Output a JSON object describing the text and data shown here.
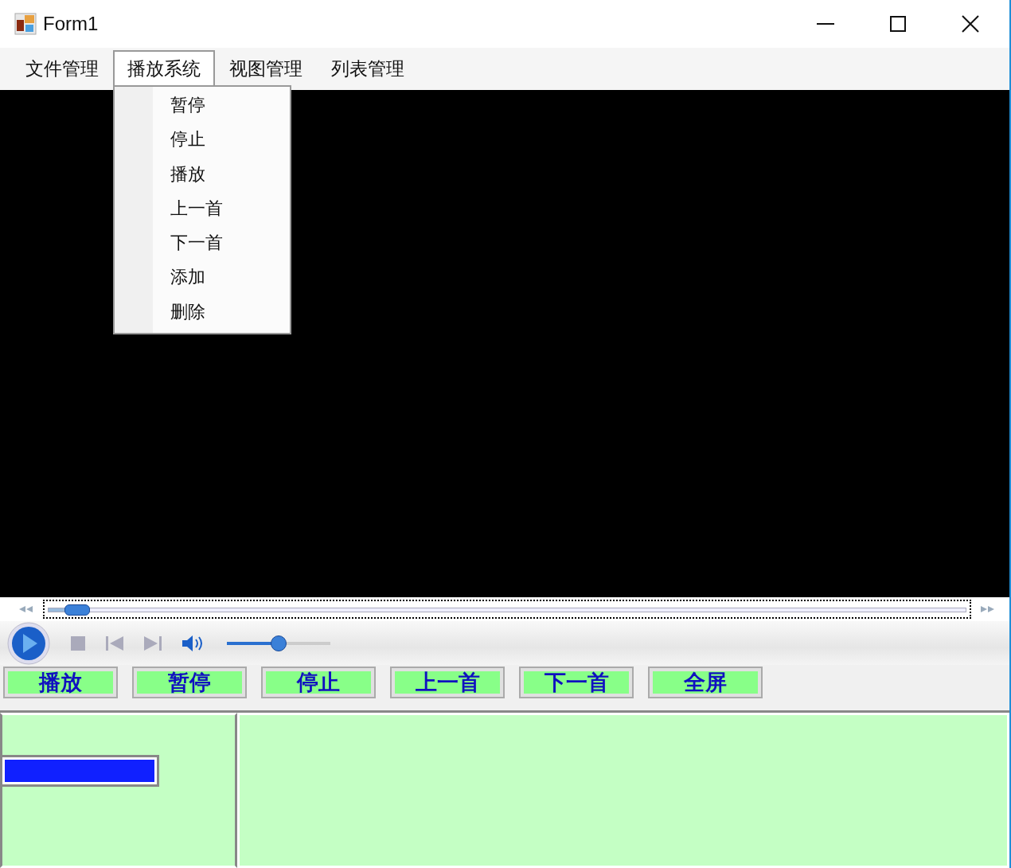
{
  "window": {
    "title": "Form1"
  },
  "menu": [
    {
      "label": "文件管理",
      "selected": false
    },
    {
      "label": "播放系统",
      "selected": true
    },
    {
      "label": "视图管理",
      "selected": false
    },
    {
      "label": "列表管理",
      "selected": false
    }
  ],
  "dropdown": [
    "暂停",
    "停止",
    "播放",
    "上一首",
    "下一首",
    "添加",
    "删除"
  ],
  "player": {
    "seek": {
      "level": 0.02
    },
    "volume": {
      "level": 0.5
    }
  },
  "buttons": [
    "播放",
    "暂停",
    "停止",
    "上一首",
    "下一首",
    "全屏"
  ]
}
